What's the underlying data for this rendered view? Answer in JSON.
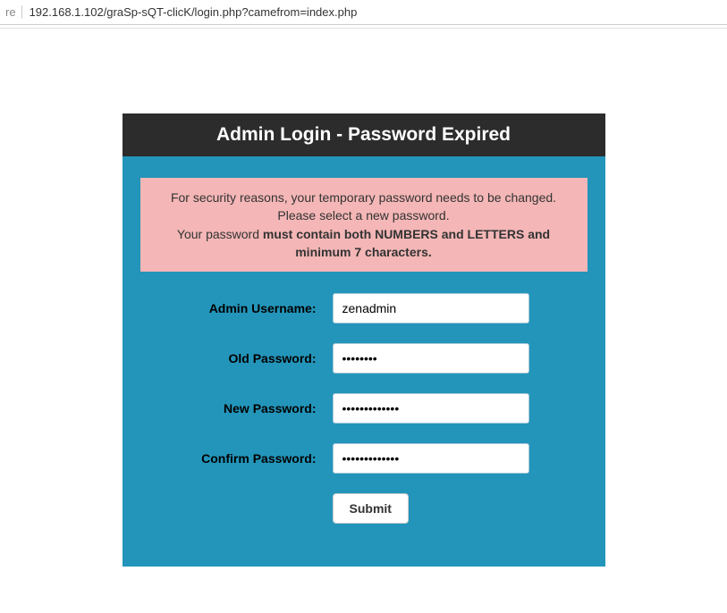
{
  "browser": {
    "address_label": "re",
    "url": "192.168.1.102/graSp-sQT-clicK/login.php?camefrom=index.php"
  },
  "header": {
    "title": "Admin Login - Password Expired"
  },
  "notice": {
    "line1": "For security reasons, your temporary password needs to be changed. Please select a new password.",
    "line2_prefix": "Your password ",
    "line2_bold": "must contain both NUMBERS and LETTERS and minimum 7 characters."
  },
  "form": {
    "username_label": "Admin Username:",
    "username_value": "zenadmin",
    "old_password_label": "Old Password:",
    "old_password_value": "••••••••",
    "new_password_label": "New Password:",
    "new_password_value": "•••••••••••••",
    "confirm_password_label": "Confirm Password:",
    "confirm_password_value": "•••••••••••••",
    "submit_label": "Submit"
  }
}
